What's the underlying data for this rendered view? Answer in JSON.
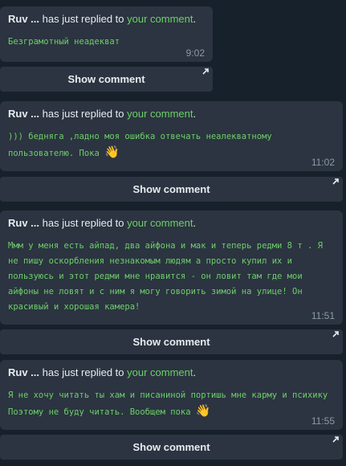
{
  "messages": [
    {
      "author": "Ruv ...",
      "action_text": " has just replied to ",
      "link_text": "your comment",
      "end_punct": ".",
      "body": "Безграмотный неадекват",
      "emoji": "",
      "time": "9:02",
      "button_label": "Show comment"
    },
    {
      "author": "Ruv ...",
      "action_text": " has just replied to ",
      "link_text": "your comment",
      "end_punct": ".",
      "body": "))) бедняга ,ладно моя ошибка отвечать неалекватному пользователю. Пока ",
      "emoji": "👋",
      "time": "11:02",
      "button_label": "Show comment"
    },
    {
      "author": "Ruv ...",
      "action_text": " has just replied to ",
      "link_text": "your comment",
      "end_punct": ".",
      "body": "Ммм у меня есть айпад, два айфона и мак и теперь редми 8 т . Я не пишу оскорбления незнакомым людям а просто купил их и пользуюсь и этот редми мне нравится - он ловит там где мои айфоны не ловят и с ним я могу говорить зимой на улице! Он красивый и хорошая камера!",
      "emoji": "",
      "time": "11:51",
      "button_label": "Show comment"
    },
    {
      "author": "Ruv ...",
      "action_text": " has just replied to ",
      "link_text": "your comment",
      "end_punct": ".",
      "body": "Я не хочу читать ты хам и писаниной портишь мне карму и психику  Поэтому не буду читать. Вообщем пока ",
      "emoji": "👋",
      "time": "11:55",
      "button_label": "Show comment"
    }
  ],
  "icons": {
    "button_corner": "arrow-up-right-icon"
  },
  "colors": {
    "background": "#17212b",
    "card": "#2b3440",
    "link": "#6ecf6a",
    "time": "#8d9aa8"
  }
}
